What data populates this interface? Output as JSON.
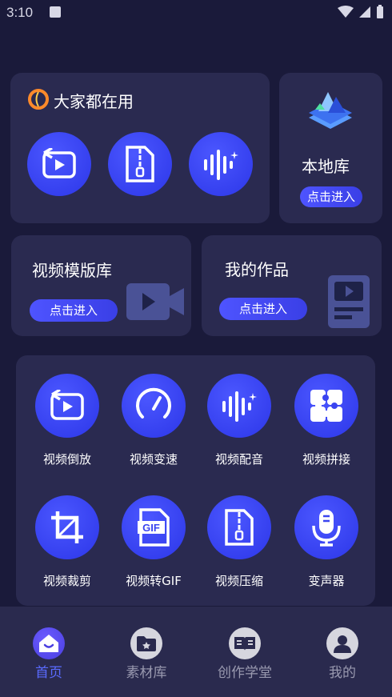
{
  "status": {
    "time": "3:10"
  },
  "popular": {
    "title": "大家都在用"
  },
  "local_library": {
    "title": "本地库",
    "button": "点击进入"
  },
  "template_library": {
    "title": "视频模版库",
    "button": "点击进入"
  },
  "my_works": {
    "title": "我的作品",
    "button": "点击进入"
  },
  "tools": [
    {
      "label": "视频倒放",
      "icon": "reverse-play-icon"
    },
    {
      "label": "视频变速",
      "icon": "speedometer-icon"
    },
    {
      "label": "视频配音",
      "icon": "waveform-icon"
    },
    {
      "label": "视频拼接",
      "icon": "puzzle-icon"
    },
    {
      "label": "视频裁剪",
      "icon": "crop-icon"
    },
    {
      "label": "视频转GIF",
      "icon": "gif-file-icon"
    },
    {
      "label": "视频压缩",
      "icon": "zip-file-icon"
    },
    {
      "label": "变声器",
      "icon": "microphone-icon"
    }
  ],
  "nav": [
    {
      "label": "首页",
      "icon": "home-icon",
      "active": true
    },
    {
      "label": "素材库",
      "icon": "folder-icon",
      "active": false
    },
    {
      "label": "创作学堂",
      "icon": "book-icon",
      "active": false
    },
    {
      "label": "我的",
      "icon": "user-icon",
      "active": false
    }
  ],
  "colors": {
    "background": "#1a1a3a",
    "card": "#2a2a50",
    "accent": "#3a44f0",
    "active_nav": "#5a6bff"
  }
}
